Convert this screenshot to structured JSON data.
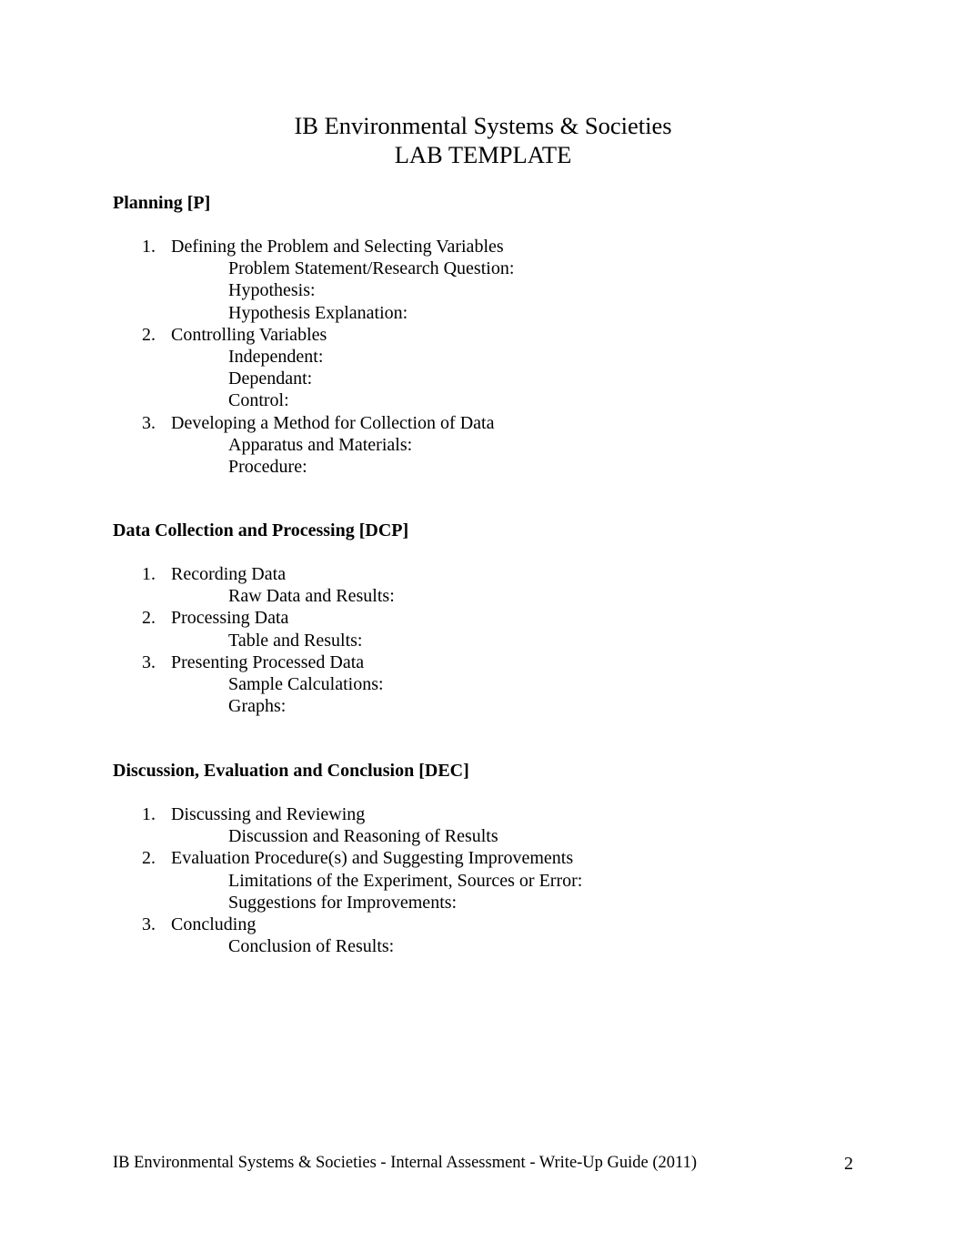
{
  "document": {
    "title_line1": "IB Environmental Systems & Societies",
    "title_line2": "LAB TEMPLATE",
    "sections": [
      {
        "heading": "Planning [P]",
        "items": [
          {
            "number": "1.",
            "label": "Defining the Problem and Selecting Variables",
            "subitems": [
              "Problem Statement/Research Question:",
              "Hypothesis:",
              "Hypothesis Explanation:"
            ]
          },
          {
            "number": "2.",
            "label": "Controlling Variables",
            "subitems": [
              "Independent:",
              "Dependant:",
              "Control:"
            ]
          },
          {
            "number": "3.",
            "label": "Developing a Method for Collection of Data",
            "subitems": [
              "Apparatus and Materials:",
              "Procedure:"
            ]
          }
        ]
      },
      {
        "heading": "Data Collection and Processing [DCP]",
        "items": [
          {
            "number": "1.",
            "label": "Recording Data",
            "subitems": [
              "Raw Data and Results:"
            ]
          },
          {
            "number": "2.",
            "label": "Processing Data",
            "subitems": [
              "Table and Results:"
            ]
          },
          {
            "number": "3.",
            "label": "Presenting Processed Data",
            "subitems": [
              "Sample Calculations:",
              "Graphs:"
            ]
          }
        ]
      },
      {
        "heading": "Discussion, Evaluation and Conclusion [DEC]",
        "items": [
          {
            "number": "1.",
            "label": "Discussing and Reviewing",
            "subitems": [
              "Discussion and Reasoning of Results"
            ]
          },
          {
            "number": "2.",
            "label": "Evaluation Procedure(s) and Suggesting Improvements",
            "subitems": [
              "Limitations of the Experiment, Sources or Error:",
              "Suggestions for Improvements:"
            ]
          },
          {
            "number": "3.",
            "label": "Concluding",
            "subitems": [
              "Conclusion of Results:"
            ]
          }
        ]
      }
    ],
    "footer": "IB Environmental Systems & Societies - Internal Assessment - Write-Up Guide (2011)",
    "page_number": "2"
  }
}
